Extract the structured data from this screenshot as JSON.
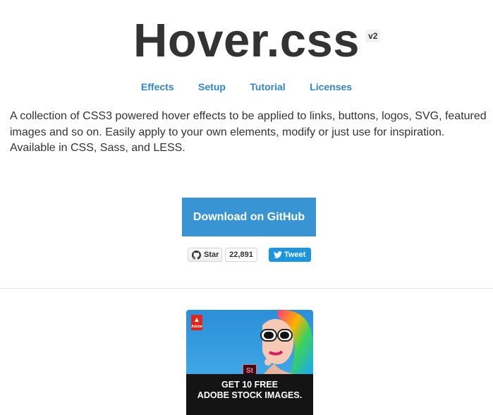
{
  "header": {
    "title": "Hover.css",
    "version": "v2"
  },
  "nav": {
    "items": [
      {
        "label": "Effects"
      },
      {
        "label": "Setup"
      },
      {
        "label": "Tutorial"
      },
      {
        "label": "Licenses"
      }
    ]
  },
  "intro": {
    "text": "A collection of CSS3 powered hover effects to be applied to links, buttons, logos, SVG, featured images and so on. Easily apply to your own elements, modify or just use for inspiration. Available in CSS, Sass, and LESS."
  },
  "download": {
    "label": "Download on GitHub"
  },
  "social": {
    "star_label": "Star",
    "star_count": "22,891",
    "tweet_label": "Tweet"
  },
  "ad": {
    "brand": "Adobe",
    "badge": "St",
    "headline_line1": "GET 10 FREE",
    "headline_line2": "ADOBE STOCK IMAGES."
  },
  "colors": {
    "accent": "#3994d4",
    "link": "#2f86c9",
    "text": "#333333",
    "tweet": "#1b95e0",
    "adobe_red": "#e1251b"
  }
}
